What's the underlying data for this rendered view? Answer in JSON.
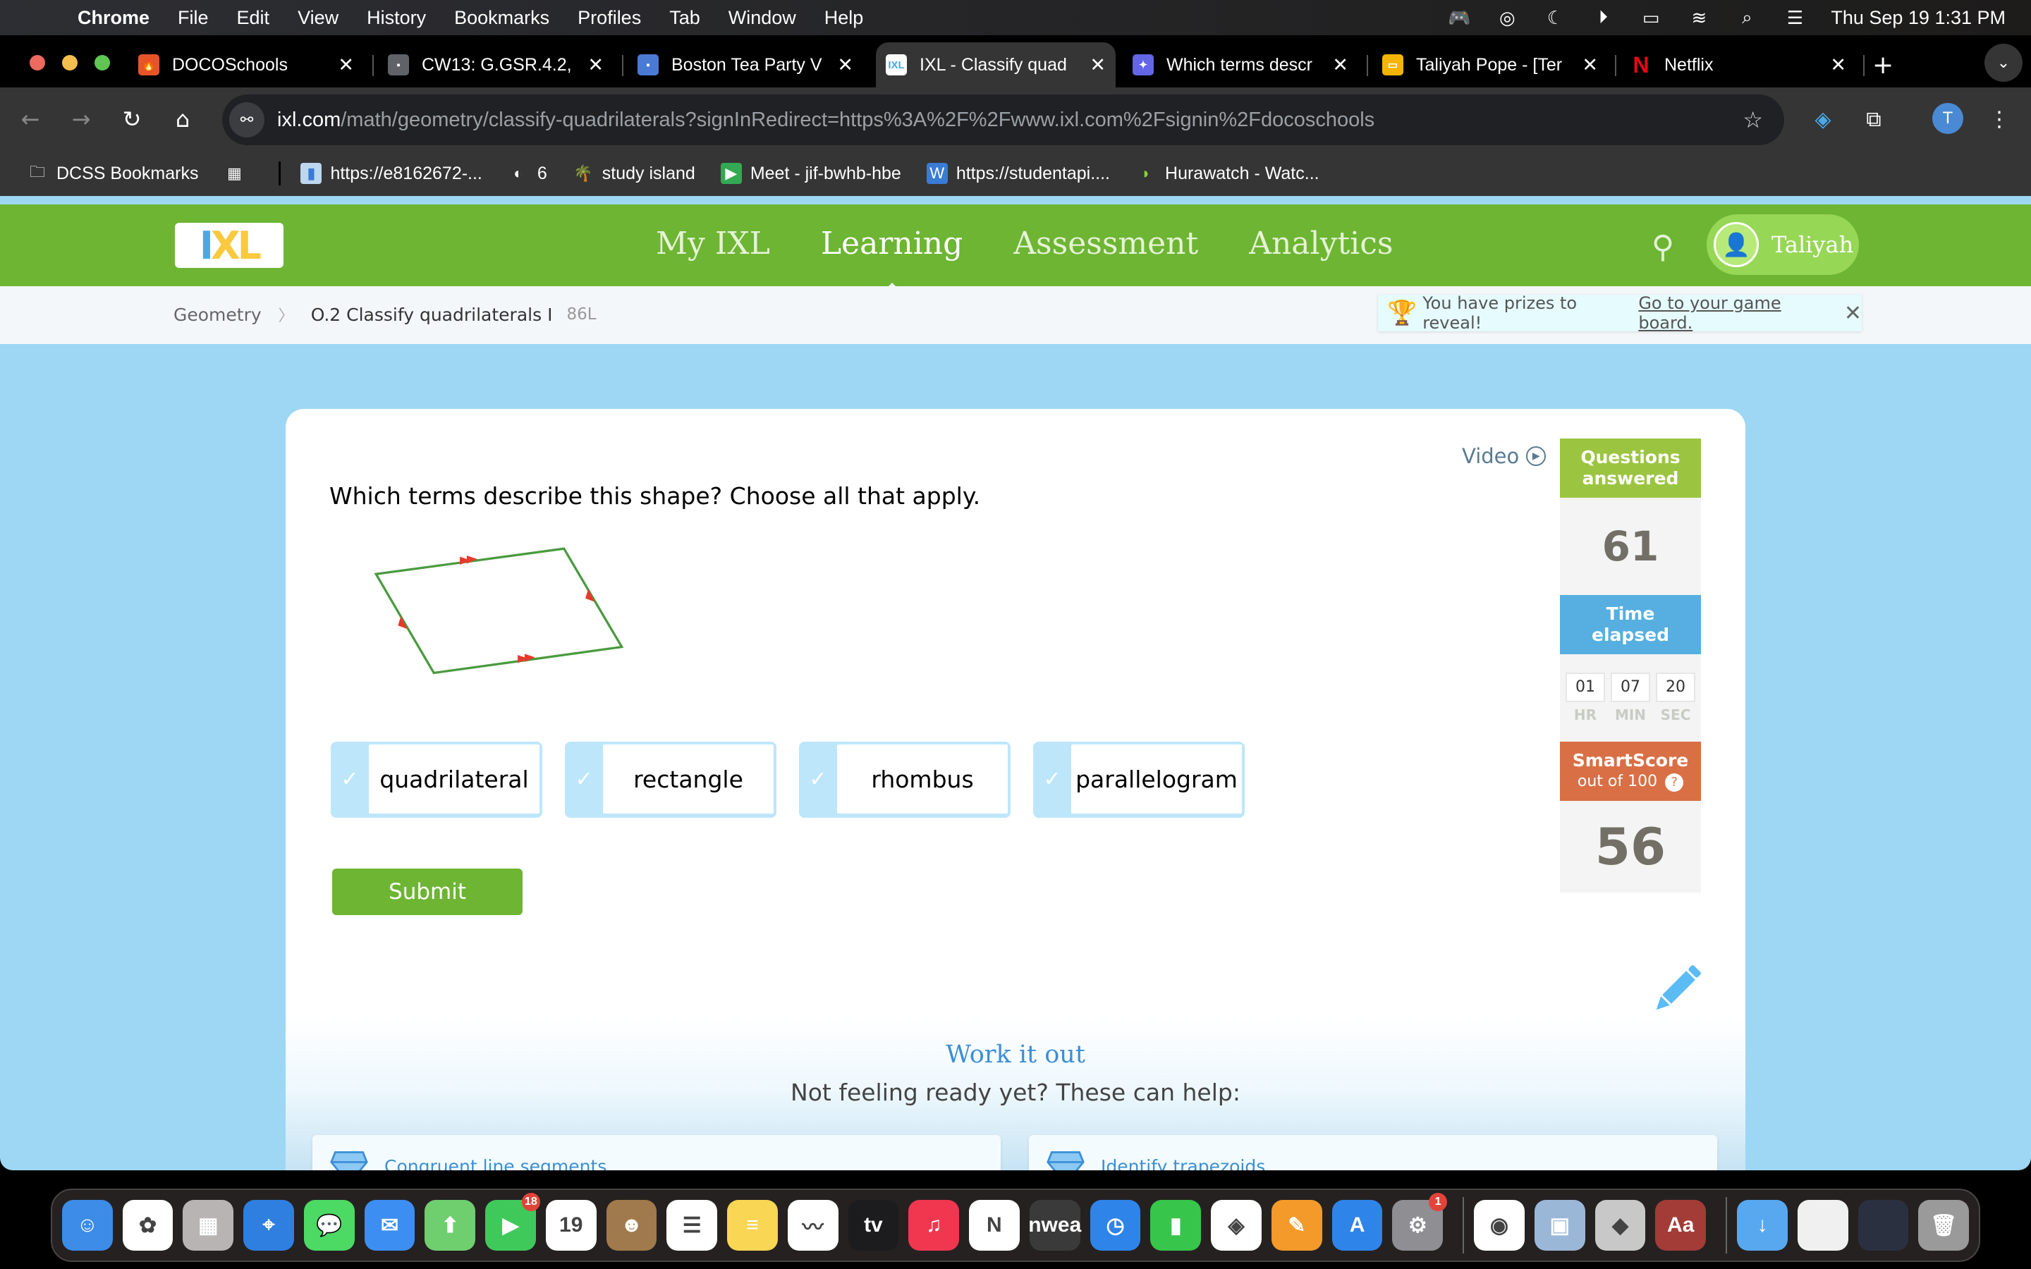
{
  "menubar": {
    "app_name": "Chrome",
    "items": [
      "File",
      "Edit",
      "View",
      "History",
      "Bookmarks",
      "Profiles",
      "Tab",
      "Window",
      "Help"
    ],
    "status_icons": [
      "gamepad-icon",
      "airdrop-icon",
      "moon-icon",
      "play-icon",
      "battery-icon",
      "wifi-icon",
      "spotlight-icon",
      "control-center-icon"
    ],
    "datetime": "Thu Sep 19  1:31 PM"
  },
  "browser": {
    "tabs": [
      {
        "title": "DOCOSchools",
        "favicon": "flame-icon",
        "color": "#e8542a"
      },
      {
        "title": "CW13: G.GSR.4.2,",
        "favicon": "classroom-icon",
        "color": "#5f6368"
      },
      {
        "title": "Boston Tea Party V",
        "favicon": "classroom-icon",
        "color": "#4a7bd4"
      },
      {
        "title": "IXL - Classify quad",
        "favicon": "ixl-icon",
        "color": "#9bc540",
        "active": true
      },
      {
        "title": "Which terms descr",
        "favicon": "assistant-icon",
        "color": "#6366e6"
      },
      {
        "title": "Taliyah Pope - [Ter",
        "favicon": "slides-icon",
        "color": "#f4b400"
      },
      {
        "title": "Netflix",
        "favicon": "netflix-icon",
        "color": "#e50914"
      }
    ],
    "url_host": "ixl.com",
    "url_path": "/math/geometry/classify-quadrilaterals?signInRedirect=https%3A%2F%2Fwww.ixl.com%2Fsignin%2Fdocoschools",
    "profile_initial": "T",
    "bookmarks": [
      {
        "label": "DCSS Bookmarks",
        "icon": "folder-icon"
      },
      {
        "label": "",
        "icon": "apps-grid-icon"
      },
      {
        "label": "https://e8162672-...",
        "icon": "bookmark-page-icon"
      },
      {
        "label": "6",
        "icon": "globe-icon"
      },
      {
        "label": "study island",
        "icon": "palm-tree-icon"
      },
      {
        "label": "Meet - jif-bwhb-hbe",
        "icon": "meet-icon"
      },
      {
        "label": "https://studentapi....",
        "icon": "wordpress-icon"
      },
      {
        "label": "Hurawatch - Watc...",
        "icon": "hurawatch-icon"
      }
    ]
  },
  "ixl": {
    "nav": [
      "My IXL",
      "Learning",
      "Assessment",
      "Analytics"
    ],
    "active_nav": "Learning",
    "user_name": "Taliyah",
    "breadcrumb": {
      "subject": "Geometry",
      "skill": "O.2 Classify quadrilaterals I",
      "skill_code": "86L"
    },
    "prize_banner": {
      "text": "You have prizes to reveal!",
      "link": "Go to your game board."
    },
    "question": "Which terms describe this shape? Choose all that apply.",
    "video_label": "Video",
    "choices": [
      {
        "label": "quadrilateral",
        "selected": false
      },
      {
        "label": "rectangle",
        "selected": false
      },
      {
        "label": "rhombus",
        "selected": false
      },
      {
        "label": "parallelogram",
        "selected": false
      }
    ],
    "submit_label": "Submit",
    "stats": {
      "questions_label_1": "Questions",
      "questions_label_2": "answered",
      "questions_answered": "61",
      "time_label_1": "Time",
      "time_label_2": "elapsed",
      "time_hr": "01",
      "time_min": "07",
      "time_sec": "20",
      "hr_label": "HR",
      "min_label": "MIN",
      "sec_label": "SEC",
      "smartscore_label": "SmartScore",
      "smartscore_sub": "out of 100",
      "smartscore": "56"
    },
    "work_it_out": {
      "title": "Work it out",
      "subtitle": "Not feeling ready yet? These can help:",
      "links": [
        "Congruent line segments",
        "Identify trapezoids"
      ]
    },
    "colors": {
      "green": "#6db533",
      "questions_header": "#9bc540",
      "time_header": "#56afe0",
      "smartscore_header": "#d96f45",
      "shape_stroke": "#4a9a3f",
      "arrow_marks": "#e8392b"
    }
  },
  "dock": {
    "apps": [
      {
        "name": "Finder",
        "color": "#3c8ce8",
        "glyph": "☺"
      },
      {
        "name": "Photos",
        "color": "#ffffff",
        "glyph": "✿"
      },
      {
        "name": "Launchpad",
        "color": "#b8b4b4",
        "glyph": "▦"
      },
      {
        "name": "Safari",
        "color": "#2f7fe0",
        "glyph": "⌖"
      },
      {
        "name": "Messages",
        "color": "#4cd964",
        "glyph": "💬"
      },
      {
        "name": "Mail",
        "color": "#3d8ef2",
        "glyph": "✉"
      },
      {
        "name": "Maps",
        "color": "#6fcf6f",
        "glyph": "⬆"
      },
      {
        "name": "FaceTime",
        "color": "#3fc95b",
        "glyph": "▶",
        "badge": "18"
      },
      {
        "name": "Calendar",
        "color": "#ffffff",
        "glyph": "19"
      },
      {
        "name": "Contacts",
        "color": "#a07a4c",
        "glyph": "☻"
      },
      {
        "name": "Reminders",
        "color": "#ffffff",
        "glyph": "☰"
      },
      {
        "name": "Notes",
        "color": "#f9d653",
        "glyph": "≡"
      },
      {
        "name": "Freeform",
        "color": "#ffffff",
        "glyph": "〰"
      },
      {
        "name": "TV",
        "color": "#1c1c1e",
        "glyph": "tv"
      },
      {
        "name": "Music",
        "color": "#f0374f",
        "glyph": "♫"
      },
      {
        "name": "News",
        "color": "#ffffff",
        "glyph": "N"
      },
      {
        "name": "NWEA",
        "color": "#3a3a3a",
        "glyph": "nwea"
      },
      {
        "name": "Keynote",
        "color": "#2f84ea",
        "glyph": "◷"
      },
      {
        "name": "Numbers",
        "color": "#37c54b",
        "glyph": "▮"
      },
      {
        "name": "Self Service",
        "color": "#ffffff",
        "glyph": "◈"
      },
      {
        "name": "Pages",
        "color": "#f39a2a",
        "glyph": "✎"
      },
      {
        "name": "App Store",
        "color": "#2f84ea",
        "glyph": "A"
      },
      {
        "name": "System Settings",
        "color": "#8e8e93",
        "glyph": "⚙",
        "badge": "1"
      }
    ],
    "recent": [
      {
        "name": "Chrome",
        "color": "#ffffff",
        "glyph": "◉"
      },
      {
        "name": "Preview",
        "color": "#9bb7d8",
        "glyph": "▣"
      },
      {
        "name": "Roblox",
        "color": "#c8c8c8",
        "glyph": "◆"
      },
      {
        "name": "Dictionary",
        "color": "#a33b37",
        "glyph": "Aa"
      }
    ],
    "other": [
      {
        "name": "Downloads",
        "color": "#58a8f0",
        "glyph": "↓"
      },
      {
        "name": "Screenshot 1",
        "color": "#f0f0f0",
        "glyph": ""
      },
      {
        "name": "Screenshot 2",
        "color": "#2a3040",
        "glyph": ""
      },
      {
        "name": "Trash",
        "color": "#9a9a9a",
        "glyph": "🗑"
      }
    ]
  }
}
